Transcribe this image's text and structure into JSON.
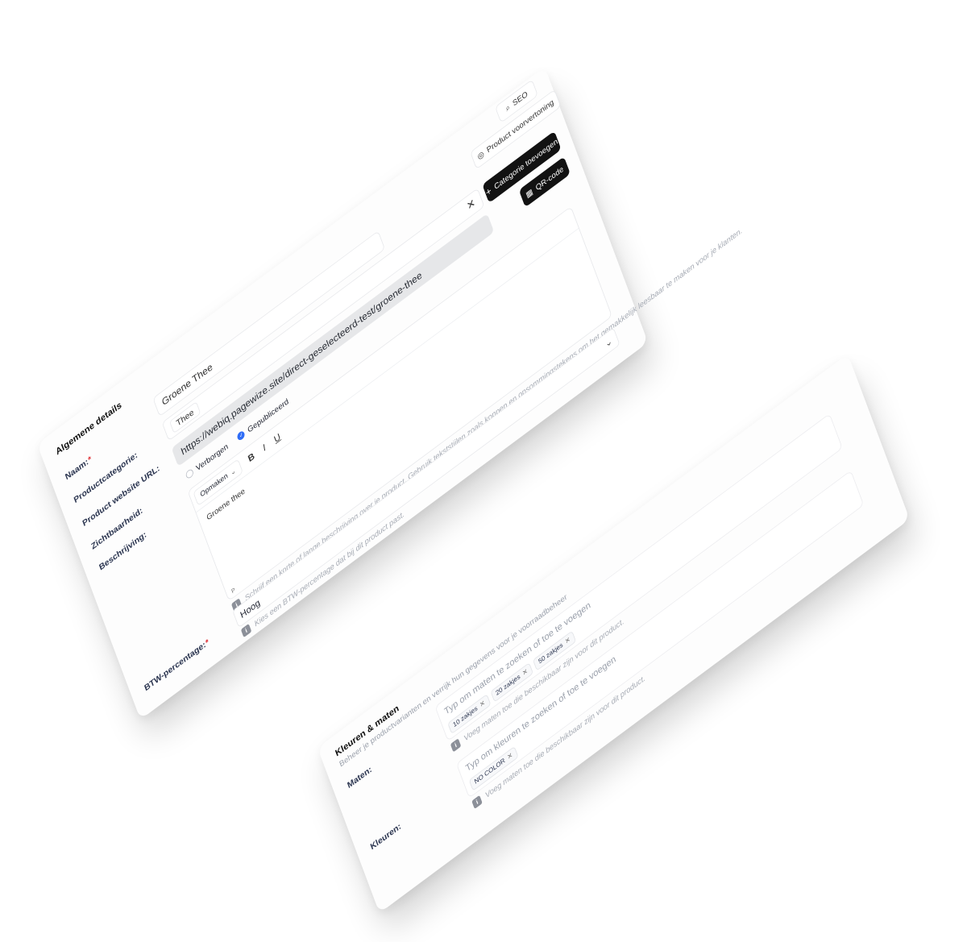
{
  "general": {
    "title": "Algemene details",
    "preview_button": "Product voorvertoning",
    "seo_button": "SEO",
    "add_category_button": "Categorie toevoegen",
    "qr_button": "QR-code",
    "labels": {
      "name": "Naam:",
      "category": "Productcategorie:",
      "url": "Product website URL:",
      "visibility": "Zichtbaarheid:",
      "description": "Beschrijving:",
      "vat": "BTW-percentage:"
    },
    "required_mark": "*",
    "name_value": "Groene Thee",
    "category_value": "Thee",
    "url_value": "https://webiq.pagewize.site/direct-geselecteerd-test/groene-thee",
    "visibility_options": [
      "Verborgen",
      "Gepubliceerd"
    ],
    "visibility_selected": "Gepubliceerd",
    "editor": {
      "format_select": "Opmaken",
      "bold": "B",
      "italic": "I",
      "underline": "U",
      "content": "Groene thee",
      "path_indicator": "P"
    },
    "description_hint": "Schrijf een korte of lange beschrijving over je product. Gebruik tekststijlen zoals koppen en opsommingstekens om het gemakkelijk leesbaar te maken voor je klanten.",
    "vat_value": "Hoog",
    "vat_hint": "Kies een BTW-percentage dat bij dit product past."
  },
  "variants": {
    "title": "Kleuren & maten",
    "subtitle": "Beheer je productvarianten en verrijk hun gegevens voor je voorraadbeheer",
    "sizes_label": "Maten:",
    "sizes_placeholder": "Typ om maten te zoeken of toe te voegen",
    "sizes_chips": [
      "10 zakjes",
      "20 zakjes",
      "50 zakjes"
    ],
    "sizes_hint": "Voeg maten toe die beschikbaar zijn voor dit product.",
    "colors_label": "Kleuren:",
    "colors_placeholder": "Typ om kleuren te zoeken of toe te voegen",
    "colors_chips": [
      "NO COLOR"
    ],
    "colors_hint": "Voeg maten toe die beschikbaar zijn voor dit product."
  },
  "icons": {
    "preview": "eye-icon",
    "seo": "search-icon",
    "add": "plus-icon",
    "qr": "qr-code-icon",
    "clear": "close-icon",
    "chevron": "chevron-down-icon",
    "info": "info-icon",
    "chip_remove": "close-icon"
  },
  "colors": {
    "accent_dark": "#121212",
    "radio_selected": "#2f6df6",
    "required": "#e0353b"
  }
}
